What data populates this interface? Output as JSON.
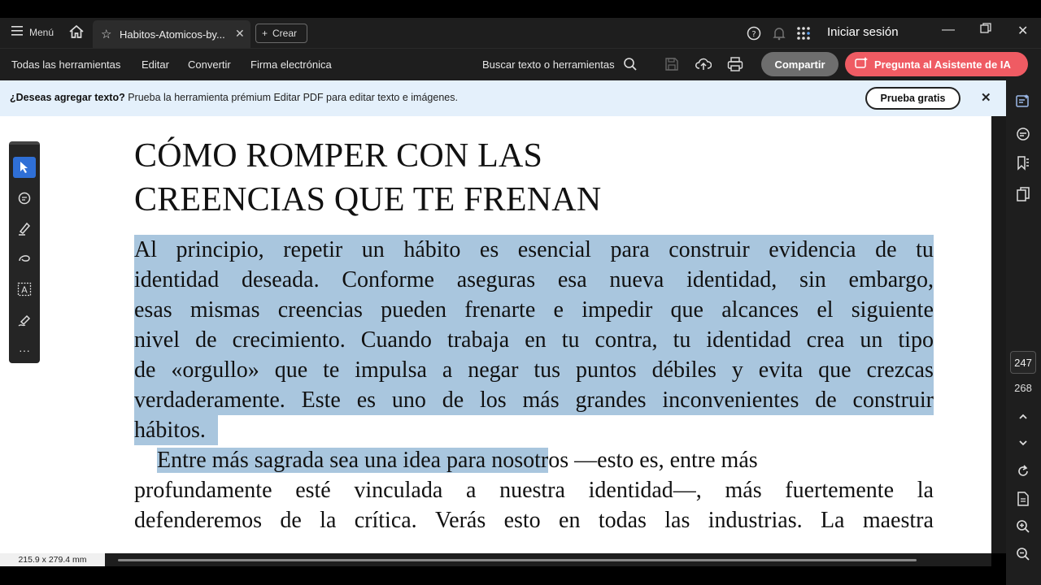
{
  "titlebar": {
    "menu_label": "Menú",
    "tab_title": "Habitos-Atomicos-by...",
    "create_label": "Crear",
    "signin_label": "Iniciar sesión"
  },
  "toolbar": {
    "items": [
      "Todas las herramientas",
      "Editar",
      "Convertir",
      "Firma electrónica"
    ],
    "search_label": "Buscar texto o herramientas",
    "share_label": "Compartir",
    "ai_label": "Pregunta al Asistente de IA"
  },
  "notice": {
    "bold": "¿Deseas agregar texto?",
    "text": " Prueba la herramienta prémium Editar PDF para editar texto e imágenes.",
    "trial_label": "Prueba gratis"
  },
  "page": {
    "title_line1": "CÓMO ROMPER CON LAS",
    "title_line2": "CREENCIAS QUE TE FRENAN",
    "p1_lines": [
      "Al principio, repetir un hábito es esencial para construir evidencia de tu",
      "identidad deseada. Conforme aseguras esa nueva identidad, sin embargo,",
      "esas mismas creencias pueden frenarte e impedir que alcances el siguiente",
      "nivel de crecimiento. Cuando trabaja en tu contra, tu identidad crea un tipo",
      "de «orgullo» que te impulsa a negar tus puntos débiles y evita que crezcas",
      "verdaderamente. Este es uno de los más grandes inconvenientes de construir",
      "hábitos."
    ],
    "p2_line1_highlighted": "Entre más sagrada sea una idea para nosotr",
    "p2_line1_rest": "os —esto es, entre más",
    "p2_lines": [
      "profundamente esté vinculada a nuestra identidad—, más fuertemente la",
      "defenderemos de la crítica. Verás esto en todas las industrias. La maestra"
    ]
  },
  "right_panel": {
    "current_page": "247",
    "total_pages": "268"
  },
  "status": {
    "page_size": "215.9 x 279.4 mm"
  },
  "colors": {
    "highlight": "#a9c6de",
    "ai_button": "#ef5b63",
    "active_tool": "#2f6fd6"
  }
}
